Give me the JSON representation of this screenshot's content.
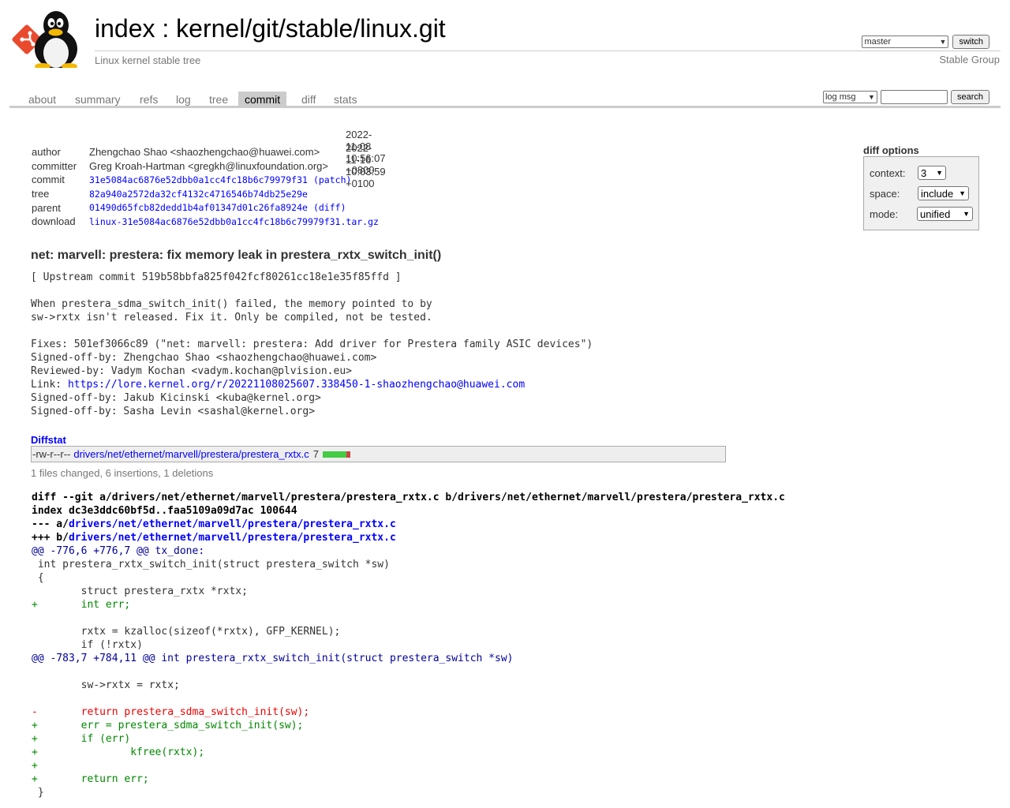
{
  "header": {
    "title": "index : kernel/git/stable/linux.git",
    "subtitle": "Linux kernel stable tree",
    "branch_selected": "master",
    "switch_label": "switch",
    "group_label": "Stable Group"
  },
  "tabs": [
    {
      "label": "about",
      "active": false
    },
    {
      "label": "summary",
      "active": false
    },
    {
      "label": "refs",
      "active": false
    },
    {
      "label": "log",
      "active": false
    },
    {
      "label": "tree",
      "active": false
    },
    {
      "label": "commit",
      "active": true
    },
    {
      "label": "diff",
      "active": false
    },
    {
      "label": "stats",
      "active": false
    }
  ],
  "search": {
    "type_selected": "log msg",
    "query": "",
    "button_label": "search"
  },
  "commit_info": {
    "author_label": "author",
    "author": "Zhengchao Shao <shaozhengchao@huawei.com>",
    "author_date": "2022-11-08 10:56:07 +0800",
    "committer_label": "committer",
    "committer": "Greg Kroah-Hartman <gregkh@linuxfoundation.org>",
    "committer_date": "2022-11-16 10:03:59 +0100",
    "commit_label": "commit",
    "commit_hash": "31e5084ac6876e52dbb0a1cc4fc18b6c79979f31",
    "commit_extra": "(patch)",
    "tree_label": "tree",
    "tree_hash": "82a940a2572da32cf4132c4716546b74db25e29e",
    "parent_label": "parent",
    "parent_hash": "01490d65fcb82dedd1b4af01347d01c26fa8924e",
    "parent_extra": "(diff)",
    "download_label": "download",
    "download_file": "linux-31e5084ac6876e52dbb0a1cc4fc18b6c79979f31.tar.gz"
  },
  "diff_options": {
    "title": "diff options",
    "context_label": "context:",
    "context_value": "3",
    "space_label": "space:",
    "space_value": "include",
    "mode_label": "mode:",
    "mode_value": "unified"
  },
  "subject": "net: marvell: prestera: fix memory leak in prestera_rxtx_switch_init()",
  "message": {
    "upstream": "[ Upstream commit 519b58bbfa825f042fcf80261cc18e1e35f85ffd ]",
    "body1": "When prestera_sdma_switch_init() failed, the memory pointed to by",
    "body2": "sw->rxtx isn't released. Fix it. Only be compiled, not be tested.",
    "fixes": "Fixes: 501ef3066c89 (\"net: marvell: prestera: Add driver for Prestera family ASIC devices\")",
    "signed1": "Signed-off-by: Zhengchao Shao <shaozhengchao@huawei.com>",
    "reviewed": "Reviewed-by: Vadym Kochan <vadym.kochan@plvision.eu>",
    "link_label": "Link: ",
    "link_url": "https://lore.kernel.org/r/20221108025607.338450-1-shaozhengchao@huawei.com",
    "signed2": "Signed-off-by: Jakub Kicinski <kuba@kernel.org>",
    "signed3": "Signed-off-by: Sasha Levin <sashal@kernel.org>"
  },
  "diffstat": {
    "header": "Diffstat",
    "mode": "-rw-r--r--",
    "file": "drivers/net/ethernet/marvell/prestera/prestera_rxtx.c",
    "count": "7",
    "insertions": 6,
    "deletions": 1,
    "summary": "1 files changed, 6 insertions, 1 deletions"
  },
  "diff": {
    "git_line": "diff --git a/drivers/net/ethernet/marvell/prestera/prestera_rxtx.c b/drivers/net/ethernet/marvell/prestera/prestera_rxtx.c",
    "index_line": "index dc3e3ddc60bf5d..faa5109a09d7ac 100644",
    "minus_prefix": "--- a/",
    "minus_file": "drivers/net/ethernet/marvell/prestera/prestera_rxtx.c",
    "plus_prefix": "+++ b/",
    "plus_file": "drivers/net/ethernet/marvell/prestera/prestera_rxtx.c",
    "lines": [
      {
        "type": "hunk",
        "text": "@@ -776,6 +776,7 @@ tx_done:"
      },
      {
        "type": "ctx",
        "text": " int prestera_rxtx_switch_init(struct prestera_switch *sw)"
      },
      {
        "type": "ctx",
        "text": " {"
      },
      {
        "type": "ctx",
        "text": " \tstruct prestera_rxtx *rxtx;"
      },
      {
        "type": "add",
        "text": "+\tint err;"
      },
      {
        "type": "ctx",
        "text": " "
      },
      {
        "type": "ctx",
        "text": " \trxtx = kzalloc(sizeof(*rxtx), GFP_KERNEL);"
      },
      {
        "type": "ctx",
        "text": " \tif (!rxtx)"
      },
      {
        "type": "hunk",
        "text": "@@ -783,7 +784,11 @@ int prestera_rxtx_switch_init(struct prestera_switch *sw)"
      },
      {
        "type": "ctx",
        "text": " "
      },
      {
        "type": "ctx",
        "text": " \tsw->rxtx = rxtx;"
      },
      {
        "type": "ctx",
        "text": " "
      },
      {
        "type": "del",
        "text": "-\treturn prestera_sdma_switch_init(sw);"
      },
      {
        "type": "add",
        "text": "+\terr = prestera_sdma_switch_init(sw);"
      },
      {
        "type": "add",
        "text": "+\tif (err)"
      },
      {
        "type": "add",
        "text": "+\t\tkfree(rxtx);"
      },
      {
        "type": "add",
        "text": "+"
      },
      {
        "type": "add",
        "text": "+\treturn err;"
      },
      {
        "type": "ctx",
        "text": " }"
      }
    ]
  },
  "colors": {
    "link": "#0000ff",
    "add": "#008800",
    "del": "#ee0000",
    "hunk": "#000099",
    "tab_active_bg": "#cccccc"
  }
}
